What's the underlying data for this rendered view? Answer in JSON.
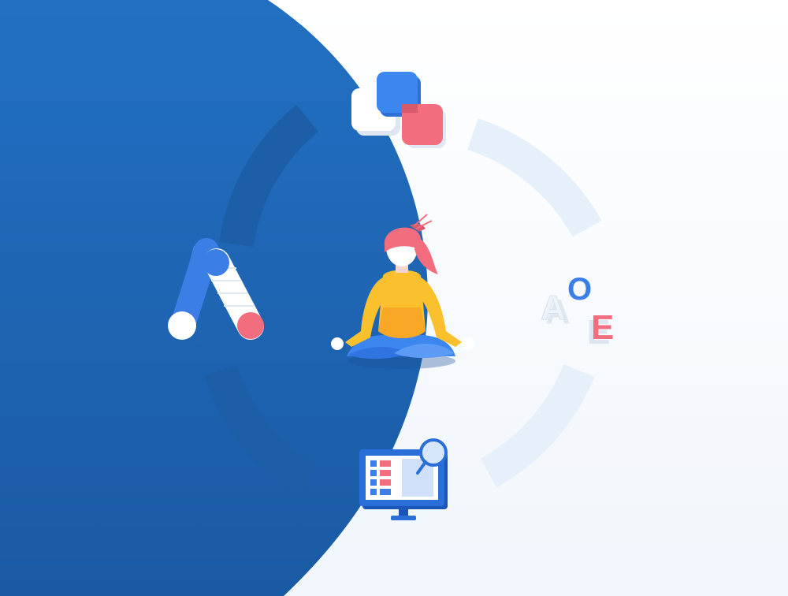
{
  "scene": {
    "title": "",
    "letters": {
      "a": "A",
      "o": "O",
      "e": "E"
    },
    "icons": {
      "ads": "google-ads-logo-icon",
      "shapes": "stacked-squares-icon",
      "letters": "translation-letters-icon",
      "monitor": "monitor-dashboard-icon",
      "person": "meditating-woman-illustration"
    }
  },
  "colors": {
    "blue_dark": "#1b5aa0",
    "blue_mid": "#2a6fc0",
    "blue_bright": "#3b7fe6",
    "red": "#f26d7d",
    "yellow": "#ffd02f",
    "orange": "#f9a825",
    "white": "#ffffff",
    "ring_light": "#e9f2fb"
  }
}
